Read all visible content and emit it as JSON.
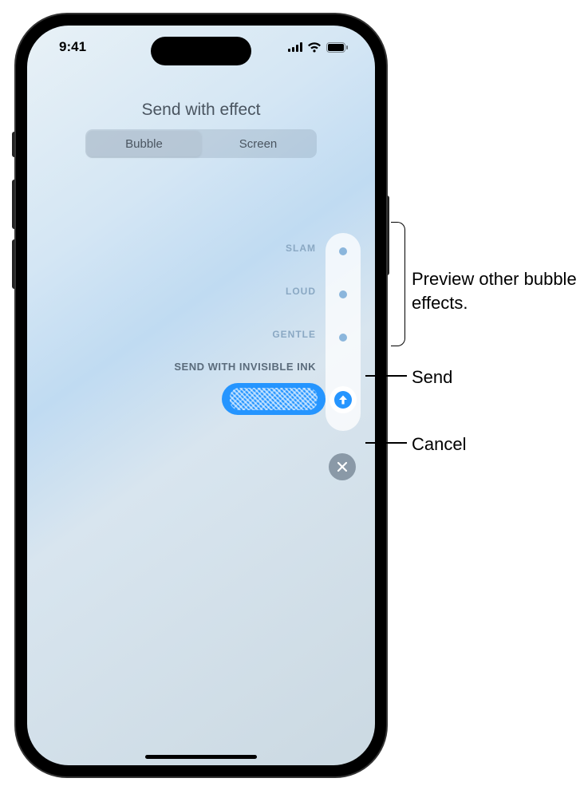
{
  "status_bar": {
    "time": "9:41"
  },
  "header": {
    "title": "Send with effect"
  },
  "segmented": {
    "bubble": "Bubble",
    "screen": "Screen",
    "active": "Bubble"
  },
  "effects": {
    "slam": "SLAM",
    "loud": "LOUD",
    "gentle": "GENTLE",
    "invisible_ink": "SEND WITH INVISIBLE INK"
  },
  "callouts": {
    "preview": "Preview other bubble effects.",
    "send": "Send",
    "cancel": "Cancel"
  }
}
